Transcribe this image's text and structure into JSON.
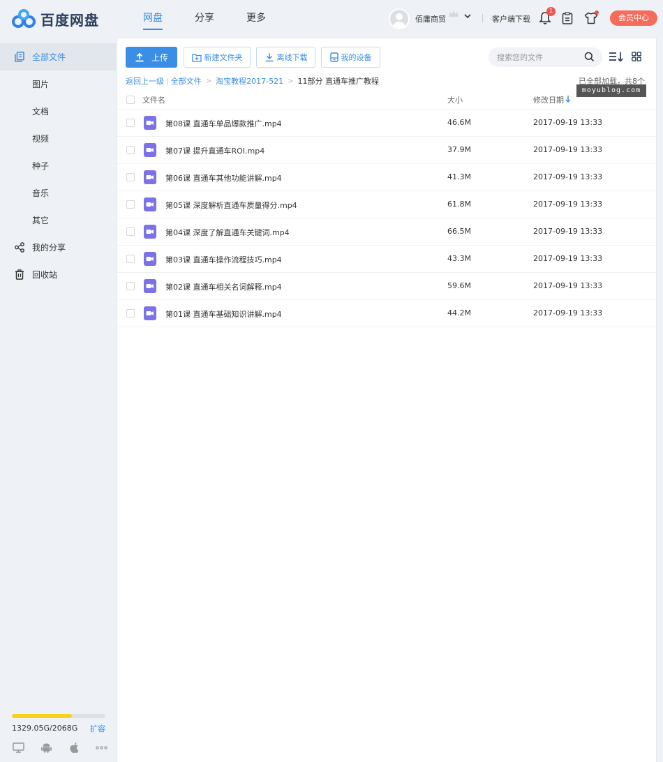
{
  "app": {
    "logo_text": "百度网盘"
  },
  "nav": {
    "tabs": [
      {
        "label": "网盘",
        "active": true
      },
      {
        "label": "分享",
        "active": false
      },
      {
        "label": "更多",
        "active": false
      }
    ]
  },
  "user": {
    "name": "佰庸商贸",
    "client_download": "客户端下载",
    "notification_count": "1",
    "vip_center": "会员中心"
  },
  "sidebar": {
    "items": [
      {
        "label": "全部文件",
        "icon": "all-files-icon",
        "active": true
      },
      {
        "label": "图片",
        "icon": "",
        "active": false
      },
      {
        "label": "文档",
        "icon": "",
        "active": false
      },
      {
        "label": "视频",
        "icon": "",
        "active": false
      },
      {
        "label": "种子",
        "icon": "",
        "active": false
      },
      {
        "label": "音乐",
        "icon": "",
        "active": false
      },
      {
        "label": "其它",
        "icon": "",
        "active": false
      },
      {
        "label": "我的分享",
        "icon": "share-icon",
        "active": false
      },
      {
        "label": "回收站",
        "icon": "trash-icon",
        "active": false
      }
    ],
    "quota": {
      "text": "1329.05G/2068G",
      "used_fraction": 0.643,
      "expand_label": "扩容"
    }
  },
  "toolbar": {
    "upload": "上传",
    "new_folder": "新建文件夹",
    "offline_download": "离线下载",
    "my_devices": "我的设备",
    "search_placeholder": "搜索您的文件"
  },
  "breadcrumb": {
    "back": "返回上一级",
    "root": "全部文件",
    "parent": "淘宝教程2017-521",
    "current": "11部分 直通车推广教程"
  },
  "status": {
    "loaded": "已全部加载，共8个"
  },
  "watermark": "moyublog.com",
  "table": {
    "headers": {
      "name": "文件名",
      "size": "大小",
      "date": "修改日期"
    },
    "rows": [
      {
        "name": "第08课 直通车单品爆款推广.mp4",
        "size": "46.6M",
        "date": "2017-09-19 13:33"
      },
      {
        "name": "第07课 提升直通车ROI.mp4",
        "size": "37.9M",
        "date": "2017-09-19 13:33"
      },
      {
        "name": "第06课 直通车其他功能讲解.mp4",
        "size": "41.3M",
        "date": "2017-09-19 13:33"
      },
      {
        "name": "第05课 深度解析直通车质量得分.mp4",
        "size": "61.8M",
        "date": "2017-09-19 13:33"
      },
      {
        "name": "第04课 深度了解直通车关键词.mp4",
        "size": "66.5M",
        "date": "2017-09-19 13:33"
      },
      {
        "name": "第03课 直通车操作流程技巧.mp4",
        "size": "43.3M",
        "date": "2017-09-19 13:33"
      },
      {
        "name": "第02课 直通车相关名词解释.mp4",
        "size": "59.6M",
        "date": "2017-09-19 13:33"
      },
      {
        "name": "第01课 直通车基础知识讲解.mp4",
        "size": "44.2M",
        "date": "2017-09-19 13:33"
      }
    ]
  },
  "colors": {
    "accent": "#3a8ee6",
    "video_icon": "#7b72e9",
    "quota_fill": "#f8d11c",
    "vip_button": "#f56c5b"
  }
}
